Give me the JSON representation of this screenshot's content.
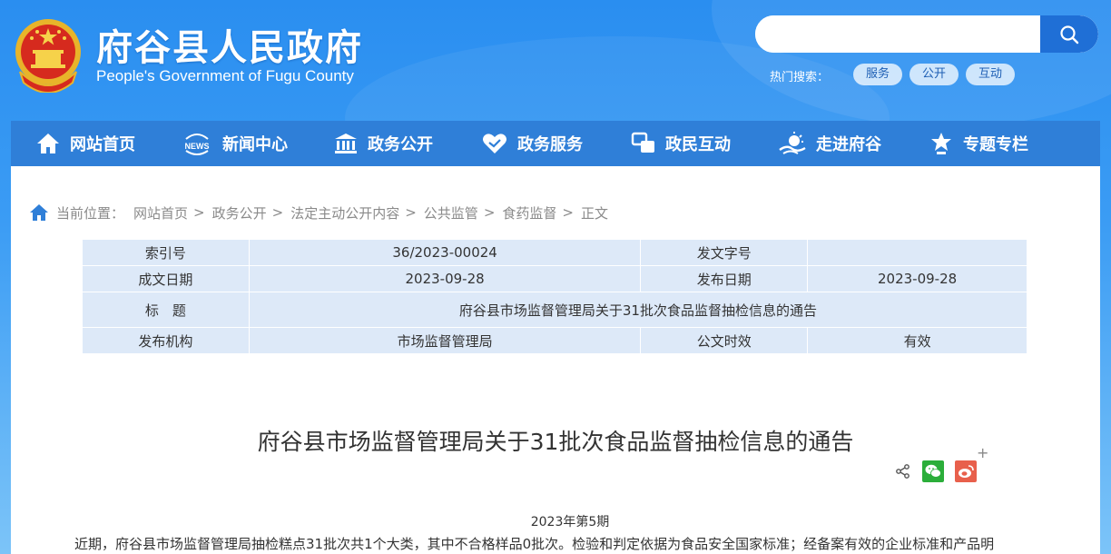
{
  "header": {
    "title": "府谷县人民政府",
    "subtitle": "People's Government of Fugu County",
    "search_placeholder": "",
    "hot_label": "热门搜索：",
    "hot_tags": [
      "服务",
      "公开",
      "互动"
    ]
  },
  "nav": {
    "items": [
      "网站首页",
      "新闻中心",
      "政务公开",
      "政务服务",
      "政民互动",
      "走进府谷",
      "专题专栏"
    ]
  },
  "breadcrumb": {
    "label": "当前位置：",
    "items": [
      "网站首页",
      "政务公开",
      "法定主动公开内容",
      "公共监管",
      "食药监督",
      "正文"
    ]
  },
  "info": {
    "index_label": "索引号",
    "index_value": "36/2023-00024",
    "doc_no_label": "发文字号",
    "doc_no_value": "",
    "created_label": "成文日期",
    "created_value": "2023-09-28",
    "published_label": "发布日期",
    "published_value": "2023-09-28",
    "title_label": "标　题",
    "title_value": "府谷县市场监督管理局关于31批次食品监督抽检信息的通告",
    "org_label": "发布机构",
    "org_value": "市场监督管理局",
    "validity_label": "公文时效",
    "validity_value": "有效"
  },
  "article": {
    "title": "府谷县市场监督管理局关于31批次食品监督抽检信息的通告",
    "issue": "2023年第5期",
    "paragraph": "近期，府谷县市场监督管理局抽检糕点31批次共1个大类，其中不合格样品0批次。检验和判定依据为食品安全国家标准；经备案有效的企业标准和产品明"
  },
  "share": {
    "plus": "+"
  },
  "colors": {
    "header_blue": "#2a8ef0",
    "nav_blue": "#2f7fd8",
    "table_bg": "#dde9f8",
    "wechat_green": "#2bae3a",
    "weibo_red": "#e8604c"
  }
}
